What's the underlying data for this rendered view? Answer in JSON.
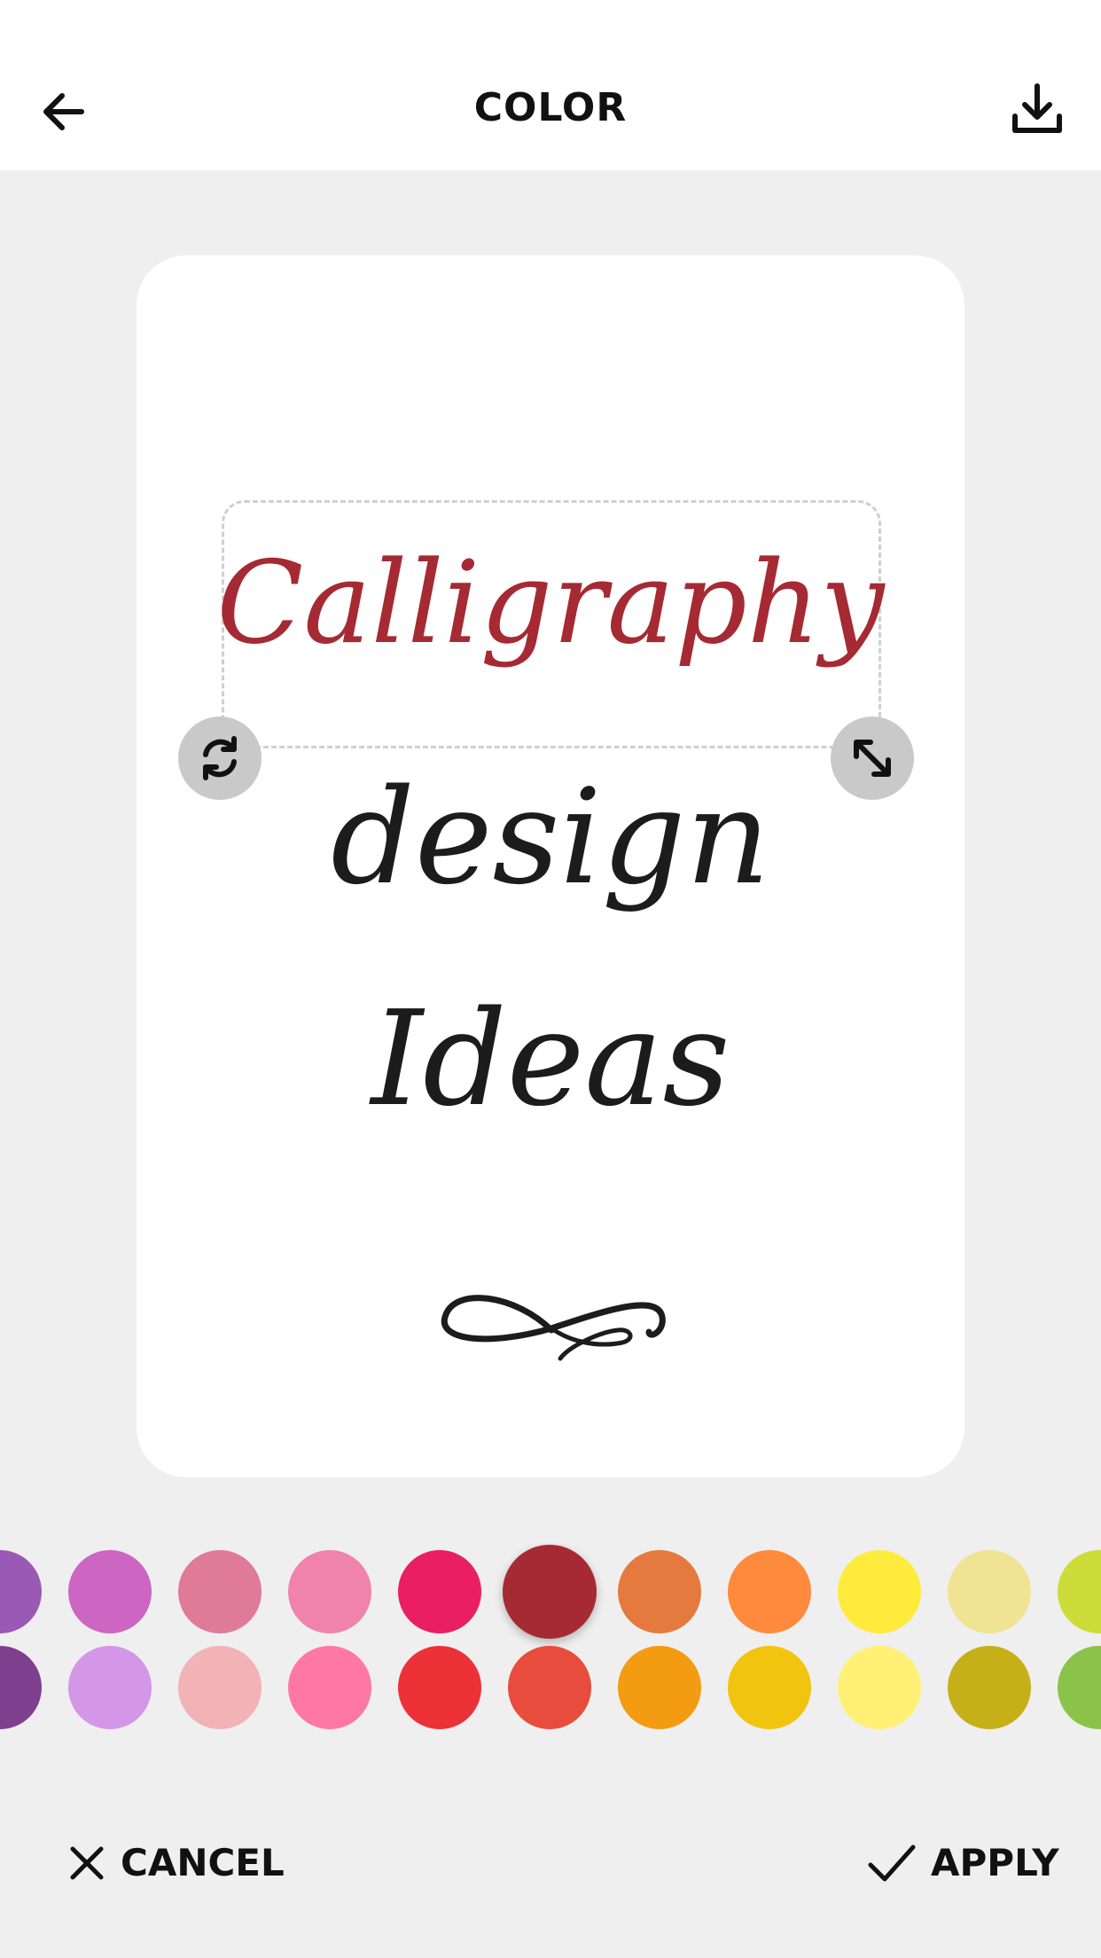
{
  "header": {
    "title": "COLOR",
    "back_icon": "arrow-left-icon",
    "download_icon": "download-icon"
  },
  "canvas": {
    "lines": [
      "Calligraphy",
      "design",
      "Ideas"
    ],
    "selected_line_color": "#a52a33",
    "text_color": "#1c1c1c",
    "flourish_icon": "flourish-ornament-icon",
    "rotate_handle_icon": "rotate-icon",
    "scale_handle_icon": "resize-icon"
  },
  "palette": {
    "row1": [
      "#9b59b6",
      "#cc66c2",
      "#df7b99",
      "#f083a9",
      "#e91e63",
      "#a52a33",
      "#e57a3f",
      "#ff8a3d",
      "#ffeb3b",
      "#f0e494",
      "#cddc39"
    ],
    "row2": [
      "#7e3f8f",
      "#d497e8",
      "#f2b3b6",
      "#ff77a4",
      "#ec3237",
      "#e74c3c",
      "#f39c12",
      "#f1c40f",
      "#fff176",
      "#c6b018",
      "#8bc34a"
    ],
    "selected": "#a52a33"
  },
  "footer": {
    "cancel_label": "CANCEL",
    "apply_label": "APPLY"
  }
}
